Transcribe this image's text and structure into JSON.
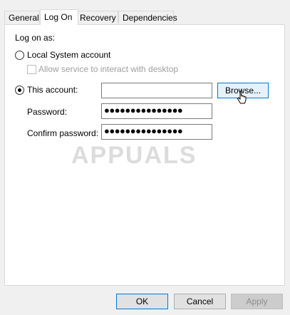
{
  "tabs": [
    {
      "label": "General",
      "active": false
    },
    {
      "label": "Log On",
      "active": true
    },
    {
      "label": "Recovery",
      "active": false
    },
    {
      "label": "Dependencies",
      "active": false
    }
  ],
  "logon": {
    "heading": "Log on as:",
    "local_system_label": "Local System account",
    "local_system_selected": false,
    "allow_interact_label": "Allow service to interact with desktop",
    "allow_interact_checked": false,
    "this_account_label": "This account:",
    "this_account_selected": true,
    "account_value": "",
    "browse_label": "Browse...",
    "password_label": "Password:",
    "password_value": "●●●●●●●●●●●●●●●",
    "confirm_label": "Confirm password:",
    "confirm_value": "●●●●●●●●●●●●●●●"
  },
  "watermark": {
    "text": "APPUALS"
  },
  "footer": {
    "ok_label": "OK",
    "cancel_label": "Cancel",
    "apply_label": "Apply"
  }
}
